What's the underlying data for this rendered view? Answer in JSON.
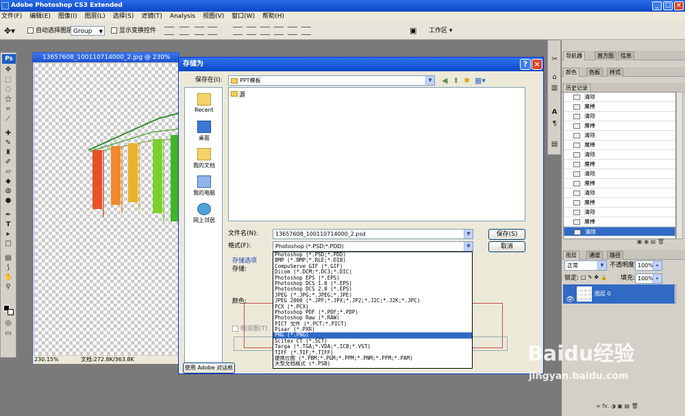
{
  "app": {
    "title": "Adobe Photoshop CS3 Extended",
    "menu": [
      "文件(F)",
      "编辑(E)",
      "图像(I)",
      "图层(L)",
      "选择(S)",
      "滤镜(T)",
      "Analysis",
      "视图(V)",
      "窗口(W)",
      "帮助(H)"
    ]
  },
  "options_bar": {
    "auto_select_label": "自动选择图层",
    "auto_select_value": "Group",
    "show_transform_label": "显示变换控件",
    "workspace_label": "工作区 ▾"
  },
  "tools_logo": "Ps",
  "document": {
    "title": "13657608_100110714000_2.jpg @ 230%",
    "zoom": "230.15%",
    "doc_size": "文档:272.8K/363.8K",
    "chart_bar_colors": [
      "#e8502a",
      "#f08a2c",
      "#e8b22e",
      "#7ecf2e",
      "#3fb52a"
    ]
  },
  "dialog": {
    "title": "存储为",
    "save_in_label": "保存在(I):",
    "save_in_value": "PPT模板",
    "folder_item": "源",
    "places": [
      "Recent",
      "桌面",
      "我的文档",
      "我的电脑",
      "网上邻居"
    ],
    "filename_label": "文件名(N):",
    "filename_value": "13657608_100110714000_2.psd",
    "format_label": "格式(F):",
    "format_value": "Photoshop (*.PSD;*.PDD)",
    "save_button": "保存(S)",
    "cancel_button": "取消",
    "save_options_label": "存储选项",
    "save_label": "存储:",
    "color_label": "颜色:",
    "thumbnail_label": "缩览图(T)",
    "use_adobe_dialog": "使用 Adobe 对话框",
    "format_options": [
      "Photoshop (*.PSD;*.PDD)",
      "BMP (*.BMP;*.RLE;*.DIB)",
      "CompuServe GIF (*.GIF)",
      "Dicom (*.DCM;*.DC3;*.DIC)",
      "Photoshop EPS (*.EPS)",
      "Photoshop DCS 1.0 (*.EPS)",
      "Photoshop DCS 2.0 (*.EPS)",
      "JPEG (*.JPG;*.JPEG;*.JPE)",
      "JPEG 2000 (*.JPF;*.JPX;*.JP2;*.J2C;*.J2K;*.JPC)",
      "PCX (*.PCX)",
      "Photoshop PDF (*.PDF;*.PDP)",
      "Photoshop Raw (*.RAW)",
      "PICT 文件 (*.PCT;*.PICT)",
      "Pixar (*.PXR)",
      "PNG (*.PNG)",
      "Scitex CT (*.SCT)",
      "Targa (*.TGA;*.VDA;*.ICB;*.VST)",
      "TIFF (*.TIF;*.TIFF)",
      "便携位图 (*.PBM;*.PGM;*.PPM;*.PNM;*.PFM;*.PAM)",
      "大型文档格式 (*.PSB)"
    ],
    "highlighted_option": "PNG (*.PNG)"
  },
  "panels": {
    "top_tabs": [
      "导航器",
      "直方图",
      "信息"
    ],
    "color_tabs": [
      "颜色",
      "色板",
      "样式"
    ],
    "history_tab": "历史记录",
    "history_items": [
      "清除",
      "魔棒",
      "清除",
      "魔棒",
      "清除",
      "魔棒",
      "清除",
      "魔棒",
      "清除",
      "魔棒",
      "清除",
      "魔棒",
      "清除",
      "魔棒",
      "清除"
    ],
    "layers_tabs": [
      "图层",
      "通道",
      "路径"
    ],
    "blend_mode": "正常",
    "opacity_label": "不透明度:",
    "opacity_value": "100%",
    "lock_label": "锁定:",
    "fill_label": "填充:",
    "fill_value": "100%",
    "layer_name": "图层 0"
  },
  "watermark": {
    "line1": "Baidu经验",
    "line2": "jingyan.baidu.com"
  }
}
